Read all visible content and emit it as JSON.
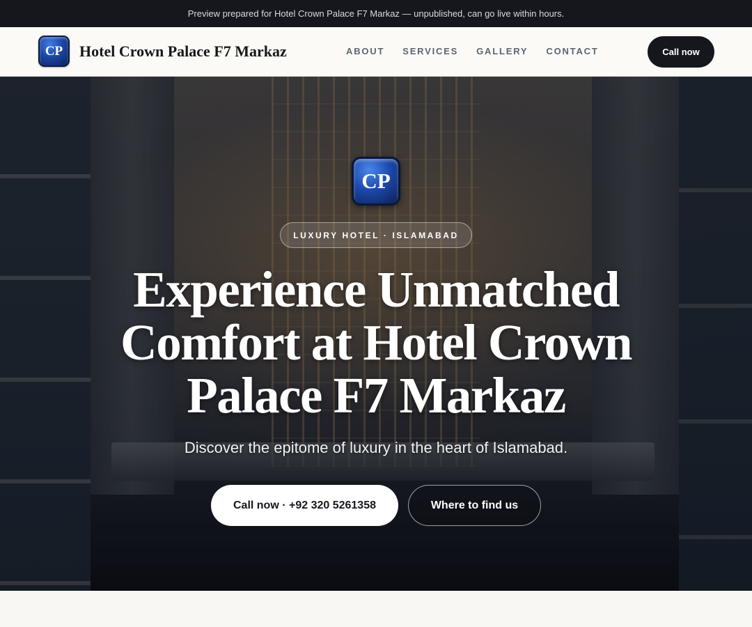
{
  "topbar": {
    "notice": "Preview prepared for Hotel Crown Palace F7 Markaz — unpublished, can go live within hours."
  },
  "header": {
    "logo_text": "CP",
    "brand_name": "Hotel Crown Palace F7 Markaz",
    "nav": [
      {
        "label": "ABOUT"
      },
      {
        "label": "SERVICES"
      },
      {
        "label": "GALLERY"
      },
      {
        "label": "CONTACT"
      }
    ],
    "call_label": "Call now"
  },
  "hero": {
    "logo_text": "CP",
    "tagline": "LUXURY HOTEL · ISLAMABAD",
    "headline": "Experience Unmatched Comfort at Hotel Crown Palace F7 Markaz",
    "subheadline": "Discover the epitome of luxury in the heart of Islamabad.",
    "primary_cta": "Call now · +92 320 5261358",
    "secondary_cta": "Where to find us"
  },
  "colors": {
    "dark": "#15171d",
    "logo_blue": "#1c47a5",
    "page_bg": "#f8f7f4"
  }
}
